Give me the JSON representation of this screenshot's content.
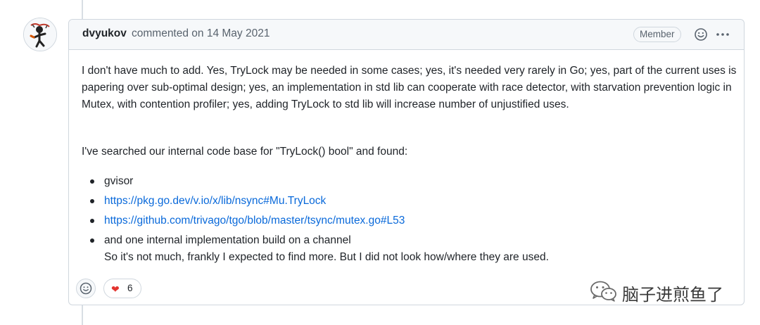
{
  "comment": {
    "author": "dvyukov",
    "meta": "commented on 14 May 2021",
    "badge": "Member",
    "paragraph1": "I don't have much to add. Yes, TryLock may be needed in some cases; yes, it's needed very rarely in Go; yes, part of the current uses is papering over sub-optimal design; yes, an implementation in std lib can cooperate with race detector, with starvation prevention logic in Mutex, with contention profiler; yes, adding TryLock to std lib will increase number of unjustified uses.",
    "paragraph2": "I've searched our internal code base for \"TryLock() bool\" and found:",
    "items": [
      {
        "text": "gvisor"
      },
      {
        "text": "https://pkg.go.dev/v.io/x/lib/nsync#Mu.TryLock"
      },
      {
        "text": "https://github.com/trivago/tgo/blob/master/tsync/mutex.go#L53"
      },
      {
        "text": "and one internal implementation build on a channel",
        "continuation": "So it's not much, frankly I expected to find more. But I did not look how/where they are used."
      }
    ]
  },
  "reactions": {
    "heart": {
      "icon": "heart-icon",
      "count": "6"
    }
  },
  "watermark": {
    "text": "脑子进煎鱼了"
  },
  "colors": {
    "link": "#0969da",
    "border": "#d0d7de",
    "header_bg": "#f6f8fa",
    "heart": "#e3342f"
  }
}
